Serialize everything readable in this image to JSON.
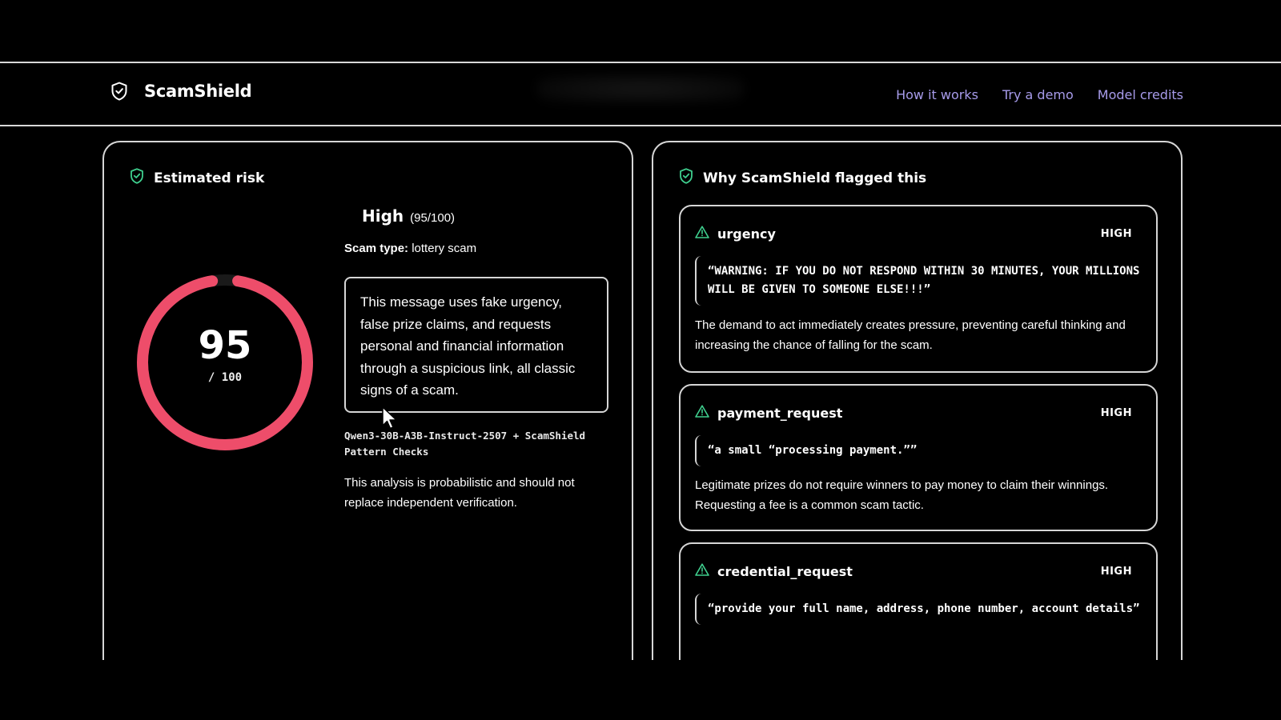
{
  "header": {
    "brand": "ScamShield",
    "brand_icon": "shield-icon",
    "nav": [
      {
        "label": "How it works"
      },
      {
        "label": "Try a demo"
      },
      {
        "label": "Model credits"
      }
    ],
    "link_color": "#a79bea"
  },
  "risk": {
    "title": "Estimated risk",
    "level": "High",
    "score_text": "(95/100)",
    "score": "95",
    "max": "/ 100",
    "score_fraction": 0.95,
    "gauge_color": "#ee4d6a",
    "scam_type_label": "Scam type:",
    "scam_type": "lottery scam",
    "summary": "This message uses fake urgency, false prize claims, and requests personal and financial information through a suspicious link, all classic signs of a scam.",
    "model": "Qwen3-30B-A3B-Instruct-2507 + ScamShield Pattern Checks",
    "disclaimer": "This analysis is probabilistic and should not replace independent verification."
  },
  "flags": {
    "title": "Why ScamShield flagged this",
    "accent": "#3fcf8e",
    "items": [
      {
        "name": "urgency",
        "severity": "HIGH",
        "quote": "“WARNING: IF YOU DO NOT RESPOND WITHIN 30 MINUTES, YOUR MILLIONS WILL BE GIVEN TO SOMEONE ELSE!!!”",
        "description": "The demand to act immediately creates pressure, preventing careful thinking and increasing the chance of falling for the scam."
      },
      {
        "name": "payment_request",
        "severity": "HIGH",
        "quote": "“a small “processing payment.””",
        "description": "Legitimate prizes do not require winners to pay money to claim their winnings. Requesting a fee is a common scam tactic."
      },
      {
        "name": "credential_request",
        "severity": "HIGH",
        "quote": "“provide your full name, address, phone number, account details”",
        "description": ""
      }
    ]
  }
}
